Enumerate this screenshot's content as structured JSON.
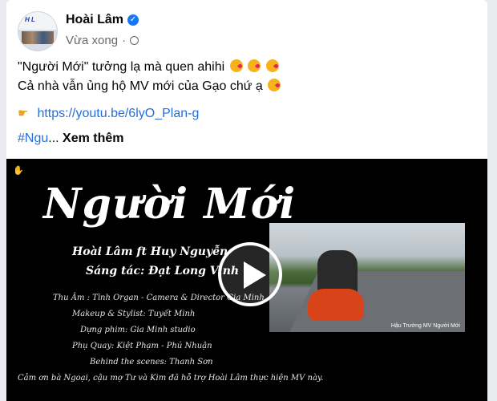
{
  "post": {
    "author": "Hoài Lâm",
    "time": "Vừa xong",
    "dot": "·",
    "line1": "\"Người Mới\" tưởng lạ mà quen ahihi",
    "line2": "Cả nhà vẫn ủng hộ MV mới của Gạo chứ ạ",
    "link": "https://youtu.be/6lyO_Plan-g",
    "hashtag": "#Ngu",
    "ellipsis": "...",
    "see_more": "Xem thêm"
  },
  "video": {
    "title": "Người Mới",
    "credit1": "Hoài Lâm ft Huy Nguyễn",
    "credit2": "Sáng tác: Đạt Long Vinh",
    "small1": "Thu Âm : Tình Organ - Camera & Director Gia Minh",
    "small2": "Makeup & Stylist: Tuyết Minh",
    "small3": "Dựng phim: Gia Minh studio",
    "small4": "Phụ Quay: Kiệt Phạm - Phú Nhuận",
    "small5": "Behind the scenes: Thanh Sơn",
    "small6": "Cảm ơn bà Ngoại, cậu mợ Tư và Kim đã hỗ trợ Hoài Lâm thực hiện MV này.",
    "photo_caption": "Hậu Trường MV Người Mới"
  },
  "icons": {
    "verified": "verified-badge-icon",
    "globe": "globe-icon",
    "play": "play-icon",
    "hand": "pointing-hand-icon"
  },
  "colors": {
    "link": "#216fdb",
    "verified": "#1877f2",
    "muted": "#65676b"
  }
}
